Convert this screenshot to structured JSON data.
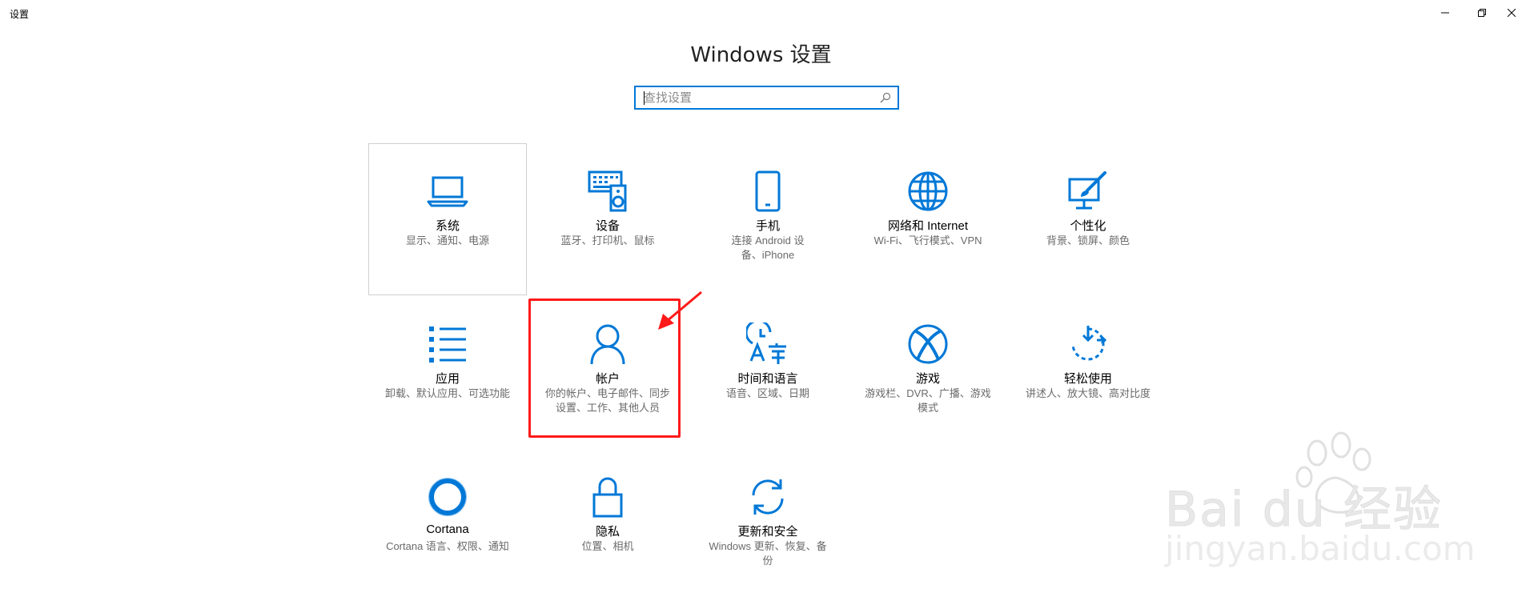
{
  "window": {
    "title": "设置",
    "minimize_label": "—",
    "restore_label": "❐",
    "close_label": "✕"
  },
  "heading": "Windows 设置",
  "search": {
    "placeholder": "查找设置",
    "value": ""
  },
  "colors": {
    "accent": "#0078d7",
    "annotation": "#ff1a1a"
  },
  "tiles": [
    {
      "name": "系统",
      "desc": "显示、通知、电源",
      "icon": "laptop-icon"
    },
    {
      "name": "设备",
      "desc": "蓝牙、打印机、鼠标",
      "icon": "devices-icon"
    },
    {
      "name": "手机",
      "desc": "连接 Android 设备、iPhone",
      "icon": "phone-icon"
    },
    {
      "name": "网络和 Internet",
      "desc": "Wi-Fi、飞行模式、VPN",
      "icon": "globe-icon"
    },
    {
      "name": "个性化",
      "desc": "背景、锁屏、颜色",
      "icon": "personalization-icon"
    },
    {
      "name": "应用",
      "desc": "卸载、默认应用、可选功能",
      "icon": "apps-list-icon"
    },
    {
      "name": "帐户",
      "desc": "你的帐户、电子邮件、同步设置、工作、其他人员",
      "icon": "person-icon"
    },
    {
      "name": "时间和语言",
      "desc": "语音、区域、日期",
      "icon": "time-language-icon"
    },
    {
      "name": "游戏",
      "desc": "游戏栏、DVR、广播、游戏模式",
      "icon": "xbox-icon"
    },
    {
      "name": "轻松使用",
      "desc": "讲述人、放大镜、高对比度",
      "icon": "ease-of-access-icon"
    },
    {
      "name": "Cortana",
      "desc": "Cortana 语言、权限、通知",
      "icon": "cortana-icon"
    },
    {
      "name": "隐私",
      "desc": "位置、相机",
      "icon": "lock-icon"
    },
    {
      "name": "更新和安全",
      "desc": "Windows 更新、恢复、备份",
      "icon": "sync-icon"
    }
  ],
  "watermark": {
    "brand": "Bai du 经验",
    "url": "jingyan.baidu.com"
  }
}
